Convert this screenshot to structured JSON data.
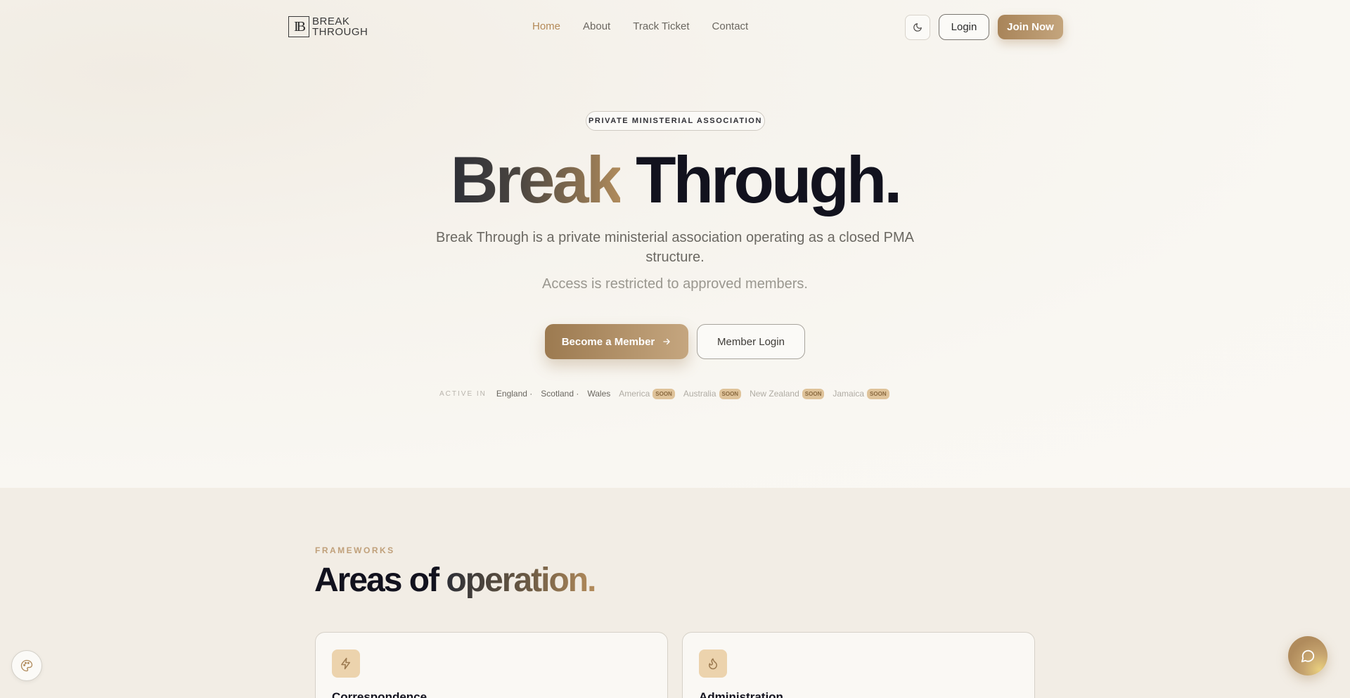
{
  "header": {
    "logo_mark": "IB",
    "logo_line1": "BREAK",
    "logo_line2": "THROUGH",
    "nav": [
      {
        "label": "Home"
      },
      {
        "label": "About"
      },
      {
        "label": "Track Ticket"
      },
      {
        "label": "Contact"
      }
    ],
    "login_label": "Login",
    "join_label": "Join Now"
  },
  "hero": {
    "badge": "PRIVATE MINISTERIAL ASSOCIATION",
    "title_word1": "Break",
    "title_word2": "Through.",
    "description": "Break Through is a private ministerial association operating as a closed PMA structure.",
    "subtext": "Access is restricted to approved members.",
    "primary_button": "Become a Member",
    "secondary_button": "Member Login",
    "regions_label": "ACTIVE IN",
    "regions": [
      {
        "name": "England",
        "sep": "·"
      },
      {
        "name": "Scotland",
        "sep": "·"
      },
      {
        "name": "Wales",
        "sep": ""
      }
    ],
    "coming_soon": [
      {
        "name": "America",
        "badge": "SOON"
      },
      {
        "name": "Australia",
        "badge": "SOON"
      },
      {
        "name": "New Zealand",
        "badge": "SOON"
      },
      {
        "name": "Jamaica",
        "badge": "SOON"
      }
    ]
  },
  "frameworks": {
    "eyebrow": "FRAMEWORKS",
    "title_plain": "Areas of",
    "title_accent": "operation.",
    "cards": [
      {
        "title": "Correspondence",
        "icon": "lightning-icon"
      },
      {
        "title": "Administration",
        "icon": "flame-icon"
      }
    ]
  },
  "colors": {
    "accent": "#b48a58",
    "background": "#f7f4ee",
    "dark": "#12121e"
  }
}
